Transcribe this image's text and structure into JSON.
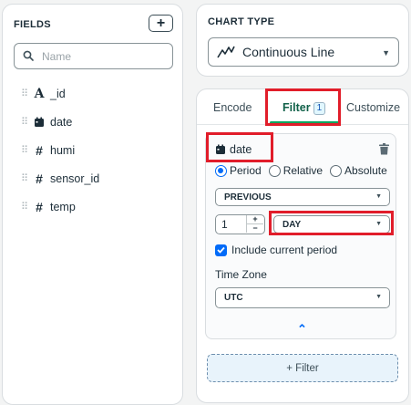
{
  "fields_panel": {
    "title": "FIELDS",
    "add_label": "+",
    "search_placeholder": "Name",
    "items": [
      {
        "name": "_id",
        "icon": "string-type-icon",
        "icon_glyph": "A"
      },
      {
        "name": "date",
        "icon": "date-type-icon",
        "icon_glyph": ""
      },
      {
        "name": "humi",
        "icon": "number-type-icon",
        "icon_glyph": "#"
      },
      {
        "name": "sensor_id",
        "icon": "number-type-icon",
        "icon_glyph": "#"
      },
      {
        "name": "temp",
        "icon": "number-type-icon",
        "icon_glyph": "#"
      }
    ]
  },
  "chart_type": {
    "title": "CHART TYPE",
    "selected": "Continuous Line"
  },
  "tabs": [
    {
      "label": "Encode",
      "active": false
    },
    {
      "label": "Filter",
      "active": true,
      "badge": "1"
    },
    {
      "label": "Customize",
      "active": false
    }
  ],
  "filter": {
    "field": "date",
    "modes": [
      {
        "label": "Period",
        "selected": true
      },
      {
        "label": "Relative",
        "selected": false
      },
      {
        "label": "Absolute",
        "selected": false
      }
    ],
    "period_select": "PREVIOUS",
    "amount": "1",
    "unit_select": "DAY",
    "include_current_label": "Include current period",
    "include_current": true,
    "timezone_label": "Time Zone",
    "timezone": "UTC",
    "collapse_glyph": "⌃"
  },
  "add_filter_label": "+ Filter",
  "colors": {
    "accent_green": "#00a35c",
    "accent_blue": "#016bf8",
    "highlight_red": "#e11d2a"
  }
}
